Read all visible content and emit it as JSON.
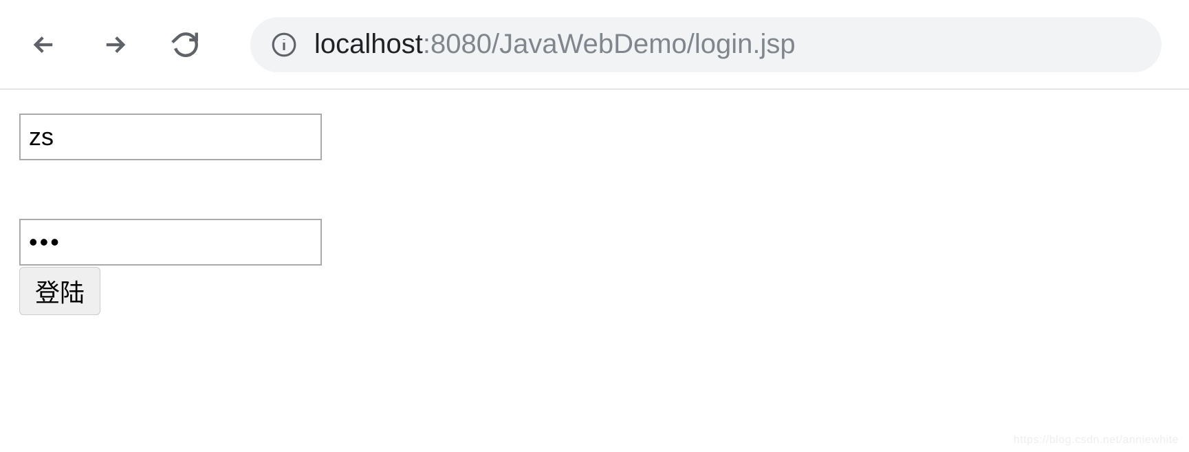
{
  "addressBar": {
    "host": "localhost",
    "path": ":8080/JavaWebDemo/login.jsp"
  },
  "form": {
    "usernameValue": "zs",
    "passwordValue": "•••",
    "submitLabel": "登陆"
  },
  "watermark": "https://blog.csdn.net/anniewhite"
}
